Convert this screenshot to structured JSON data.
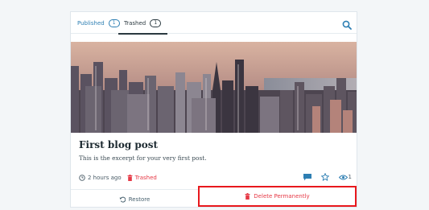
{
  "tabs": {
    "published": {
      "label": "Published",
      "count": "1"
    },
    "trashed": {
      "label": "Trashed",
      "count": "1"
    }
  },
  "post": {
    "title": "First blog post",
    "excerpt": "This is the excerpt for your very first post.",
    "time": "2 hours ago",
    "status": "Trashed",
    "views": "1"
  },
  "footer": {
    "restore_label": "Restore",
    "delete_label": "Delete Permanently"
  },
  "colors": {
    "accent": "#2e7fb3",
    "danger": "#e63946",
    "highlight_border": "#e8181d"
  }
}
